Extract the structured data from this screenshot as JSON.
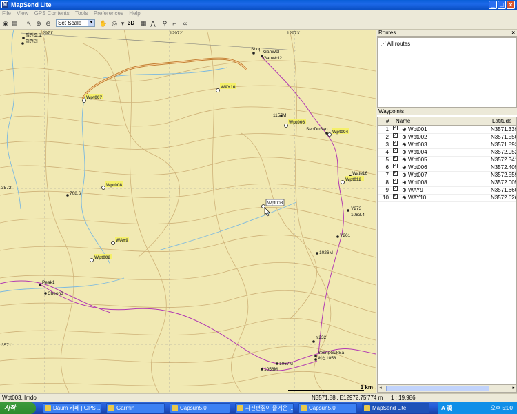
{
  "window": {
    "title": "MapSend Lite",
    "app_icon": "M"
  },
  "menu": [
    "File",
    "View",
    "GPS Contents",
    "Tools",
    "Preferences",
    "Help"
  ],
  "toolbar": {
    "scale_select": "Set Scale",
    "button_3d": "3D"
  },
  "map": {
    "grid_labels": [
      "12971'",
      "12972'",
      "12973'",
      "3572'",
      "3571'"
    ],
    "places": {
      "village_korean_1": "필천조교",
      "village_korean_2": "이천리",
      "shop": "Shop",
      "ganwol": "GanWol",
      "ganwol2": "GanWol2",
      "peak1": "Peak1",
      "cheon3": "Cheon3",
      "alt_708": "708.6",
      "alt_1157": "1157M",
      "seodu": "SeoDuSan",
      "water16": "Wate16",
      "y273": "Y273",
      "alt_1083": "1083.4",
      "y261": "Y261",
      "alt_1026": "1026M",
      "y232": "Y232",
      "yeong": "YeongGukSa",
      "seoksan": "서산1058",
      "alt_1067": "1067M",
      "alt_1058": "1058M"
    },
    "waypoints": {
      "way10": "WAY10",
      "wpt007": "Wpt007",
      "wpt006": "Wpt006",
      "wpt004": "Wpt004",
      "wpt008": "Wpt008",
      "way9": "WAY9",
      "wpt002": "Wpt002",
      "wpt003_tooltip": "Wpt003",
      "wpt012": "Wpt012"
    },
    "scale_label": "1 km"
  },
  "routes": {
    "title": "Routes",
    "items": [
      "All routes"
    ]
  },
  "waypoints_panel": {
    "title": "Waypoints",
    "columns": [
      "#",
      "Name",
      "Latitude"
    ],
    "rows": [
      {
        "n": "1",
        "name": "Wpt001",
        "lat": "N3571.339'"
      },
      {
        "n": "2",
        "name": "Wpt002",
        "lat": "N3571.550'"
      },
      {
        "n": "3",
        "name": "Wpt003",
        "lat": "N3571.893'"
      },
      {
        "n": "4",
        "name": "Wpt004",
        "lat": "N3572.052'"
      },
      {
        "n": "5",
        "name": "Wpt005",
        "lat": "N3572.341'"
      },
      {
        "n": "6",
        "name": "Wpt006",
        "lat": "N3572.405'"
      },
      {
        "n": "7",
        "name": "Wpt007",
        "lat": "N3572.559'"
      },
      {
        "n": "8",
        "name": "Wpt008",
        "lat": "N3572.005'"
      },
      {
        "n": "9",
        "name": "WAY9",
        "lat": "N3571.660'"
      },
      {
        "n": "10",
        "name": "WAY10",
        "lat": "N3572.626'"
      }
    ]
  },
  "status": {
    "left": "Wpt003, Imdo",
    "coords": "N3571.88', E12972.75'",
    "elev": "774 m",
    "scale": "1 : 19,986"
  },
  "taskbar": {
    "start": "시작",
    "tasks": [
      "Daum 카페 | GPS ...",
      "Garmin",
      "Capsun5.0",
      "사진편집이 즐거운 ...",
      "Capsun5.0",
      "MapSend Lite"
    ],
    "ime": "A 漢",
    "clock": "오후 5:00"
  },
  "colors": {
    "map_bg": "#f1e9b3",
    "contour": "#c6a46a",
    "road": "#c07a2e",
    "trail": "#b23ab2",
    "stream": "#7ab8e0"
  }
}
